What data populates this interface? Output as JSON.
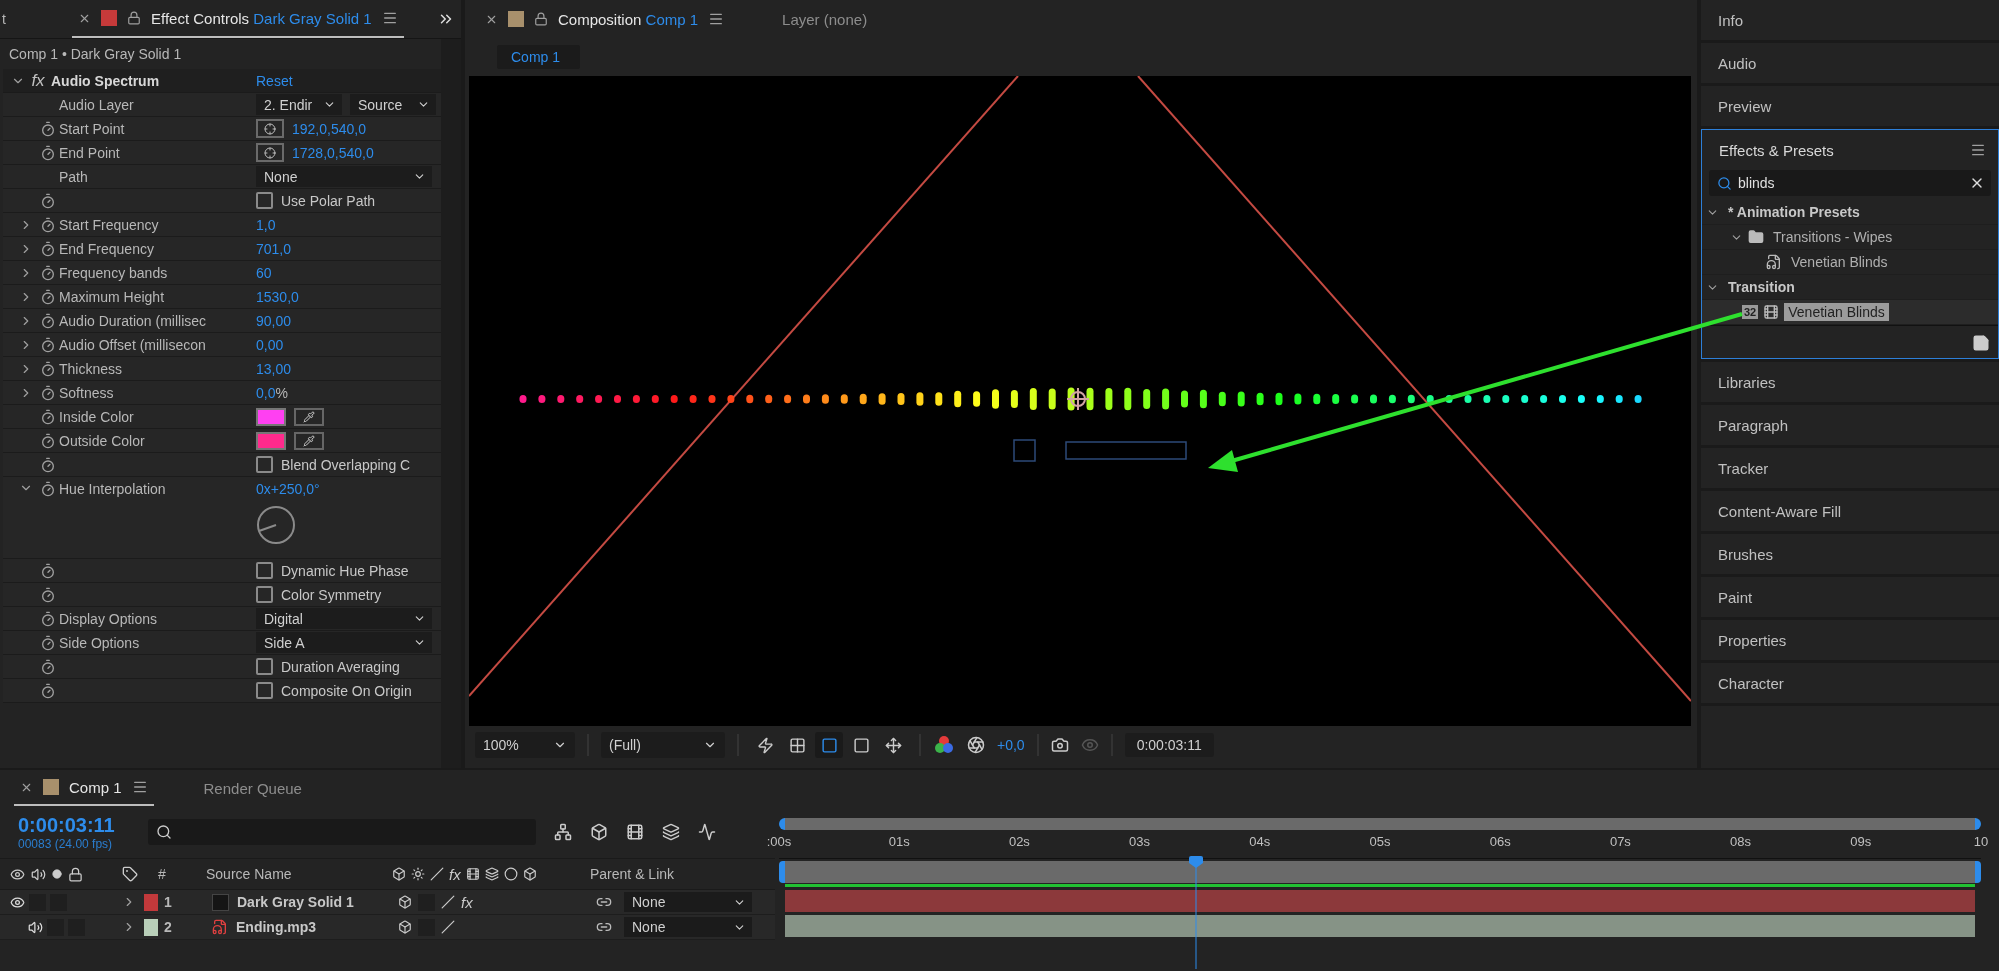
{
  "effect_controls": {
    "cut_tab": "t",
    "title": "Effect Controls",
    "layer": "Dark Gray Solid 1",
    "breadcrumb": "Comp 1 • Dark Gray Solid 1",
    "effect": {
      "fx": "fx",
      "name": "Audio Spectrum",
      "reset": "Reset",
      "expanded": true
    },
    "properties": [
      {
        "kind": "dropdown_pair",
        "label": "Audio Layer",
        "stopwatch": false,
        "options": [
          "2. Endir",
          "Source"
        ]
      },
      {
        "kind": "point",
        "label": "Start Point",
        "stopwatch": true,
        "value": "192,0,540,0"
      },
      {
        "kind": "point",
        "label": "End Point",
        "stopwatch": true,
        "value": "1728,0,540,0"
      },
      {
        "kind": "dropdown",
        "label": "Path",
        "stopwatch": false,
        "value": "None"
      },
      {
        "kind": "checkbox",
        "stopwatch": true,
        "text": "Use Polar Path",
        "checked": false
      },
      {
        "kind": "number",
        "label": "Start Frequency",
        "stopwatch": true,
        "expanded": false,
        "value": "1,0"
      },
      {
        "kind": "number",
        "label": "End Frequency",
        "stopwatch": true,
        "expanded": false,
        "value": "701,0"
      },
      {
        "kind": "number",
        "label": "Frequency bands",
        "stopwatch": true,
        "expanded": false,
        "value": "60"
      },
      {
        "kind": "number",
        "label": "Maximum Height",
        "stopwatch": true,
        "expanded": false,
        "value": "1530,0"
      },
      {
        "kind": "number",
        "label": "Audio Duration (millisec",
        "stopwatch": true,
        "expanded": false,
        "value": "90,00"
      },
      {
        "kind": "number",
        "label": "Audio Offset (millisecon",
        "stopwatch": true,
        "expanded": false,
        "value": "0,00"
      },
      {
        "kind": "number",
        "label": "Thickness",
        "stopwatch": true,
        "expanded": false,
        "value": "13,00"
      },
      {
        "kind": "number",
        "label": "Softness",
        "stopwatch": true,
        "expanded": false,
        "value": "0,0",
        "unit": "%"
      },
      {
        "kind": "color",
        "label": "Inside Color",
        "stopwatch": true,
        "color": "#ff40f2"
      },
      {
        "kind": "color",
        "label": "Outside Color",
        "stopwatch": true,
        "color": "#ff2a8c"
      },
      {
        "kind": "checkbox",
        "stopwatch": true,
        "text": "Blend Overlapping C",
        "checked": false
      },
      {
        "kind": "angle",
        "label": "Hue Interpolation",
        "stopwatch": true,
        "expanded": true,
        "value": "0x+250,0°"
      },
      {
        "kind": "checkbox",
        "stopwatch": true,
        "text": "Dynamic Hue Phase",
        "checked": false
      },
      {
        "kind": "checkbox",
        "stopwatch": true,
        "text": "Color Symmetry",
        "checked": false
      },
      {
        "kind": "dropdown",
        "label": "Display Options",
        "stopwatch": true,
        "value": "Digital"
      },
      {
        "kind": "dropdown",
        "label": "Side Options",
        "stopwatch": true,
        "value": "Side A"
      },
      {
        "kind": "checkbox",
        "stopwatch": true,
        "text": "Duration Averaging",
        "checked": false
      },
      {
        "kind": "checkbox",
        "stopwatch": true,
        "text": "Composite On Origin",
        "checked": false
      }
    ]
  },
  "composition": {
    "tabs": [
      {
        "kind": "composition",
        "title": "Composition",
        "name": "Comp 1",
        "selected": true
      },
      {
        "kind": "layer",
        "title": "Layer (none)",
        "selected": false
      }
    ],
    "viewer_tab": "Comp 1",
    "toolbar": {
      "zoom": "100%",
      "resolution": "(Full)",
      "toggles": [
        {
          "selected": false
        },
        {
          "selected": false
        },
        {
          "selected": true
        },
        {
          "selected": false
        },
        {
          "selected": false
        }
      ],
      "exposure": "+0,0",
      "timecode": "0:00:03:11"
    }
  },
  "right_panels": {
    "top": [
      "Info",
      "Audio",
      "Preview"
    ],
    "effects_presets": {
      "title": "Effects & Presets",
      "search": "blinds",
      "tree": [
        {
          "kind": "category",
          "label": "* Animation Presets",
          "expanded": true,
          "selected": false,
          "children": [
            {
              "kind": "folder",
              "label": "Transitions - Wipes",
              "expanded": true,
              "selected": false,
              "children": [
                {
                  "kind": "preset",
                  "label": "Venetian Blinds",
                  "selected": false
                }
              ]
            }
          ]
        },
        {
          "kind": "category",
          "label": "Transition",
          "expanded": true,
          "selected": false,
          "children": [
            {
              "kind": "effect",
              "badge": "32",
              "label": "Venetian Blinds",
              "selected": true
            }
          ]
        }
      ]
    },
    "bottom": [
      "Libraries",
      "Paragraph",
      "Tracker",
      "Content-Aware Fill",
      "Brushes",
      "Paint",
      "Properties",
      "Character"
    ]
  },
  "timeline": {
    "tabs": [
      {
        "kind": "comp",
        "label": "Comp 1",
        "selected": true
      },
      {
        "kind": "queue",
        "label": "Render Queue",
        "selected": false
      }
    ],
    "timecode": "0:00:03:11",
    "frame_info": "00083 (24.00 fps)",
    "columns": {
      "number": "#",
      "source": "Source Name",
      "fx": "fx",
      "parent": "Parent & Link"
    },
    "layers": [
      {
        "number": "1",
        "name": "Dark Gray Solid 1",
        "kind": "solid",
        "color": "#c2393b",
        "video": true,
        "audio": false,
        "effects": "fx",
        "parent": "None"
      },
      {
        "number": "2",
        "name": "Ending.mp3",
        "kind": "audio",
        "color": "#b9cfb9",
        "video": false,
        "audio": true,
        "parent": "None"
      }
    ],
    "ruler": [
      ":00s",
      "01s",
      "02s",
      "03s",
      "04s",
      "05s",
      "06s",
      "07s",
      "08s",
      "09s",
      "10"
    ],
    "playhead": {
      "level": 0.347
    }
  }
}
